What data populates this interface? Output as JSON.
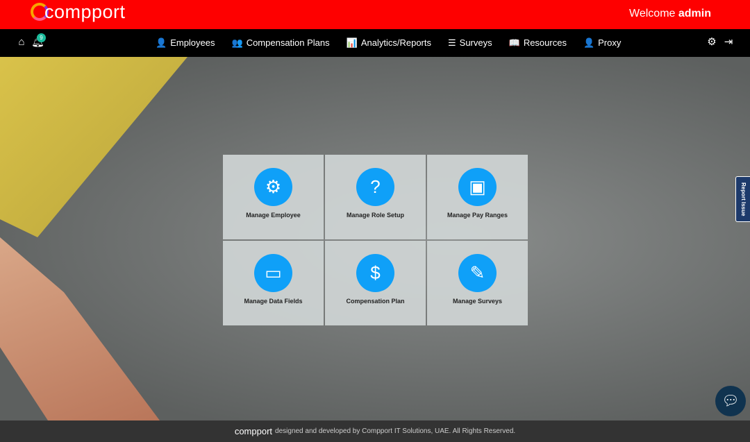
{
  "header": {
    "logo": "compport",
    "welcome": "Welcome",
    "user": "admin"
  },
  "nav": {
    "notifications": "9",
    "items": [
      {
        "label": "Employees",
        "icon": "user-icon",
        "glyph": "👤"
      },
      {
        "label": "Compensation Plans",
        "icon": "users-icon",
        "glyph": "👥"
      },
      {
        "label": "Analytics/Reports",
        "icon": "chart-icon",
        "glyph": "📊"
      },
      {
        "label": "Surveys",
        "icon": "list-icon",
        "glyph": "☰"
      },
      {
        "label": "Resources",
        "icon": "book-icon",
        "glyph": "📖"
      },
      {
        "label": "Proxy",
        "icon": "user-icon",
        "glyph": "👤"
      }
    ]
  },
  "tiles": [
    {
      "label": "Manage Employee",
      "icon": "gear-icon",
      "glyph": "⚙"
    },
    {
      "label": "Manage Role Setup",
      "icon": "role-icon",
      "glyph": "?"
    },
    {
      "label": "Manage Pay Ranges",
      "icon": "pay-ranges-icon",
      "glyph": "▣"
    },
    {
      "label": "Manage Data Fields",
      "icon": "data-fields-icon",
      "glyph": "▭"
    },
    {
      "label": "Compensation Plan",
      "icon": "money-hand-icon",
      "glyph": "$"
    },
    {
      "label": "Manage Surveys",
      "icon": "survey-icon",
      "glyph": "✎"
    }
  ],
  "report_issue": "Report Issue",
  "footer": {
    "logo": "compport",
    "text": "designed and developed by Compport IT Solutions, UAE.  All Rights Reserved."
  }
}
